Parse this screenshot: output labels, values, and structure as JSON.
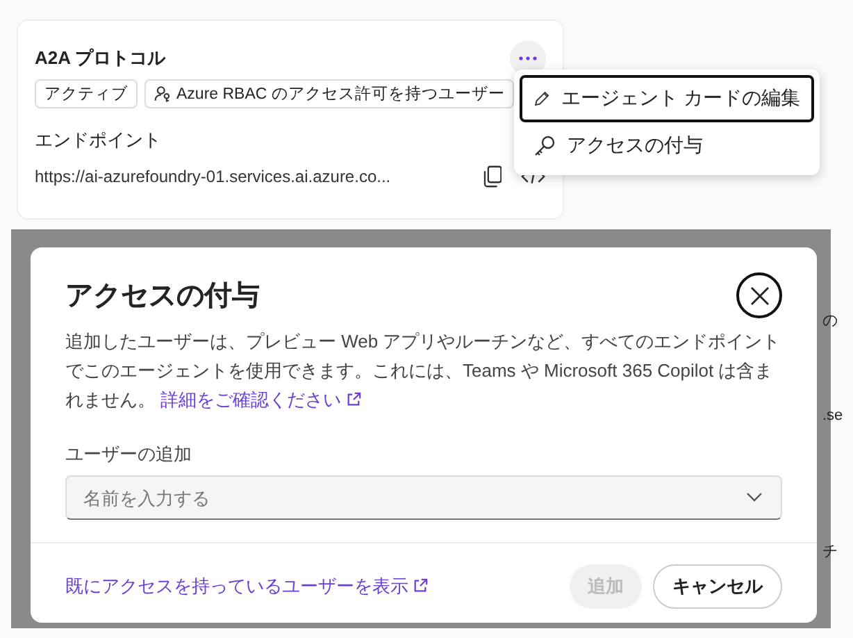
{
  "card": {
    "title": "A2A プロトコル",
    "badges": [
      {
        "kind": "plain",
        "label": "アクティブ"
      },
      {
        "kind": "icon",
        "label": "Azure RBAC のアクセス許可を持つユーザー"
      }
    ],
    "endpoint_label": "エンドポイント",
    "endpoint_url": "https://ai-azurefoundry-01.services.ai.azure.co..."
  },
  "menu": {
    "items": [
      {
        "kind": "edit",
        "label": "エージェント カードの編集",
        "focused": true
      },
      {
        "kind": "key",
        "label": "アクセスの付与",
        "focused": false
      }
    ]
  },
  "background_fragments": [
    "の",
    ".se",
    "チ"
  ],
  "dialog": {
    "title": "アクセスの付与",
    "description": "追加したユーザーは、プレビュー Web アプリやルーチンなど、すべてのエンドポイントでこのエージェントを使用できます。これには、Teams や Microsoft 365 Copilot は含まれません。",
    "link": "詳細をご確認ください",
    "field_label": "ユーザーの追加",
    "field": {
      "placeholder": "名前を入力する"
    },
    "footer_link": "既にアクセスを持っているユーザーを表示",
    "buttons": [
      {
        "kind": "primary",
        "label": "追加",
        "disabled": true
      },
      {
        "kind": "secondary",
        "label": "キャンセル",
        "disabled": false
      }
    ]
  }
}
